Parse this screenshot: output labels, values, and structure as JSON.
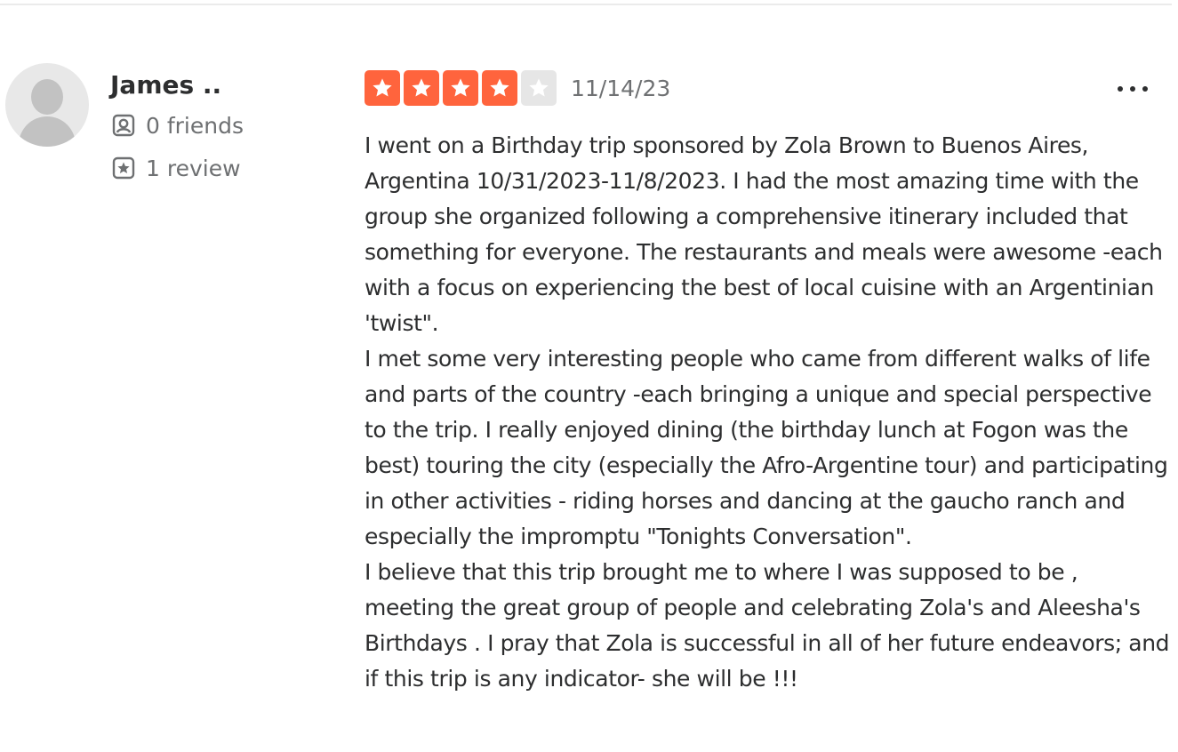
{
  "reviewer": {
    "name": "James ..",
    "friends_label": "0 friends",
    "reviews_label": "1 review",
    "avatar_icon": "default-user-avatar"
  },
  "rating": {
    "value": 4,
    "max": 5,
    "filled_color": "#ff643d",
    "empty_color": "#e6e6e6"
  },
  "review": {
    "date": "11/14/23",
    "more_icon": "ellipsis-icon",
    "text": "I went on a Birthday trip sponsored by Zola Brown to Buenos Aires, Argentina 10/31/2023-11/8/2023. I had the most amazing time with the group she organized following a comprehensive itinerary included that something for everyone. The restaurants and meals were awesome -each with a focus on experiencing the best of local cuisine with an Argentinian 'twist\".\nI met some very interesting people who came from different walks of life and parts of the country -each bringing a unique and special perspective to the trip. I really enjoyed dining (the birthday lunch at Fogon was the best) touring the city (especially the Afro-Argentine tour) and participating in other activities - riding horses and dancing at the gaucho ranch and especially the impromptu \"Tonights Conversation\".\nI believe that this trip brought me to where I was supposed to be , meeting the great group of people and celebrating Zola's and Aleesha's Birthdays . I pray that Zola is successful in all of her future endeavors; and if this trip is any indicator- she will be !!!"
  }
}
